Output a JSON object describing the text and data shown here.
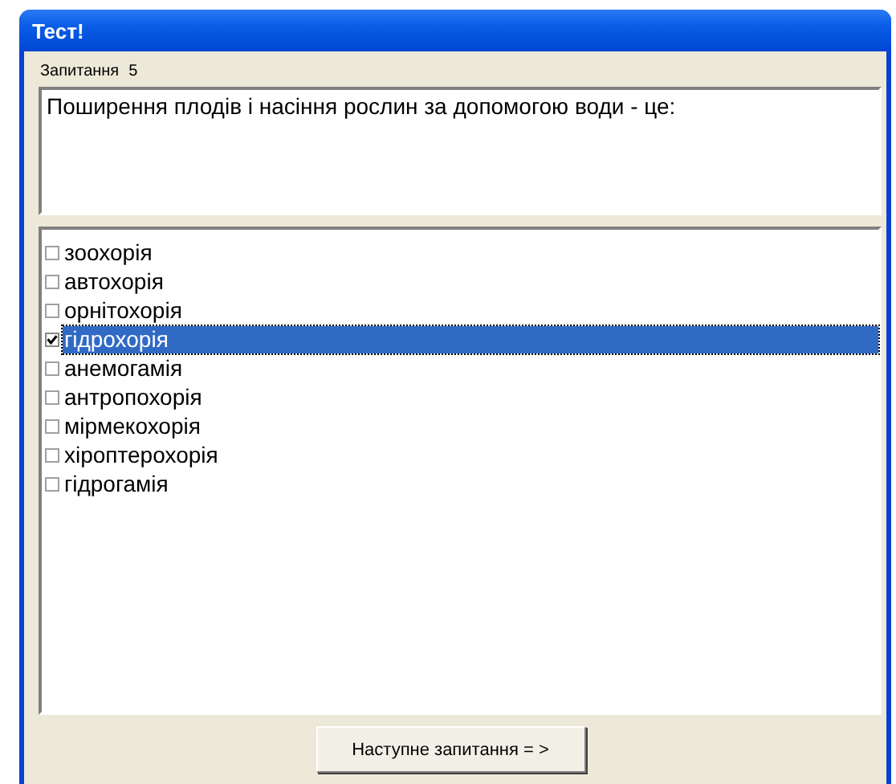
{
  "window": {
    "title": "Тест!"
  },
  "question_label": "Запитання",
  "question_number": "5",
  "question_text": "Поширення плодів і насіння рослин за допомогою води - це:",
  "options": [
    {
      "label": "зоохорія",
      "checked": false,
      "selected": false
    },
    {
      "label": "автохорія",
      "checked": false,
      "selected": false
    },
    {
      "label": "орнітохорія",
      "checked": false,
      "selected": false
    },
    {
      "label": "гідрохорія",
      "checked": true,
      "selected": true
    },
    {
      "label": "анемогамія",
      "checked": false,
      "selected": false
    },
    {
      "label": "антропохорія",
      "checked": false,
      "selected": false
    },
    {
      "label": "мірмекохорія",
      "checked": false,
      "selected": false
    },
    {
      "label": "хіроптерохорія",
      "checked": false,
      "selected": false
    },
    {
      "label": "гідрогамія",
      "checked": false,
      "selected": false
    }
  ],
  "next_button": "Наступне запитання = >"
}
